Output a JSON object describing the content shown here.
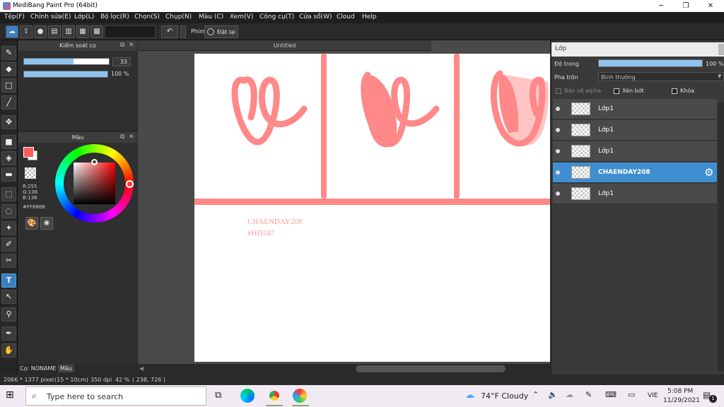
{
  "window": {
    "title": "MediBang Paint Pro (64bit)",
    "controls": [
      "─",
      "❐",
      "✕"
    ]
  },
  "menu": [
    "Tệp(F)",
    "Chỉnh sửa(E)",
    "Lớp(L)",
    "Bộ lọc(R)",
    "Chọn(S)",
    "Chụp(N)",
    "Màu (C)",
    "Xem(V)",
    "Công cụ(T)",
    "Cửa sổ(W)",
    "Cloud",
    "Help"
  ],
  "toolbar": {
    "phim_label": "Phím",
    "reset_label": "Đặt lại"
  },
  "brush_panel": {
    "title": "Kiểm soát cọ",
    "size_value": "33",
    "size_fraction": 0.58,
    "opacity_value": "100 %",
    "opacity_fraction": 1.0
  },
  "color_panel": {
    "title": "Màu",
    "r": "R:255",
    "g": "G:136",
    "b": "B:136",
    "hex": "#FF8888",
    "fg_color": "#ff5c5c",
    "bg_color": "#ffffff"
  },
  "canvas": {
    "doc_title": "Untitled",
    "text_line1": "CHAENDAY208",
    "text_line2": "#HD247",
    "accent": "#ff8888"
  },
  "layer_panel": {
    "title": "Lớp",
    "opacity_label": "Độ trong",
    "opacity_value": "100 %",
    "blend_label": "Pha trộn",
    "blend_value": "Bình thường",
    "protect_alpha": "Bảo vệ alpha",
    "clip": "Xén bớt",
    "lock": "Khóa",
    "layers": [
      {
        "name": "Lớp1",
        "selected": false
      },
      {
        "name": "Lớp1",
        "selected": false
      },
      {
        "name": "Lớp1",
        "selected": false
      },
      {
        "name": "CHAENDAY208",
        "selected": true
      },
      {
        "name": "Lớp1",
        "selected": false
      }
    ]
  },
  "bottom_tabs": {
    "brush_tab": "Cọ: NONAME",
    "color_tab": "Màu"
  },
  "status": {
    "dimensions": "2066 * 1377 pixel",
    "size_cm": "(15 * 10cm)",
    "dpi": "350 dpi",
    "zoom": "42 %",
    "coords": "( 238, 726 )"
  },
  "taskbar": {
    "search_placeholder": "Type here to search",
    "weather": "74°F  Cloudy",
    "lang": "VIE",
    "time": "5:08 PM",
    "date": "11/29/2021",
    "notif_count": "1"
  }
}
